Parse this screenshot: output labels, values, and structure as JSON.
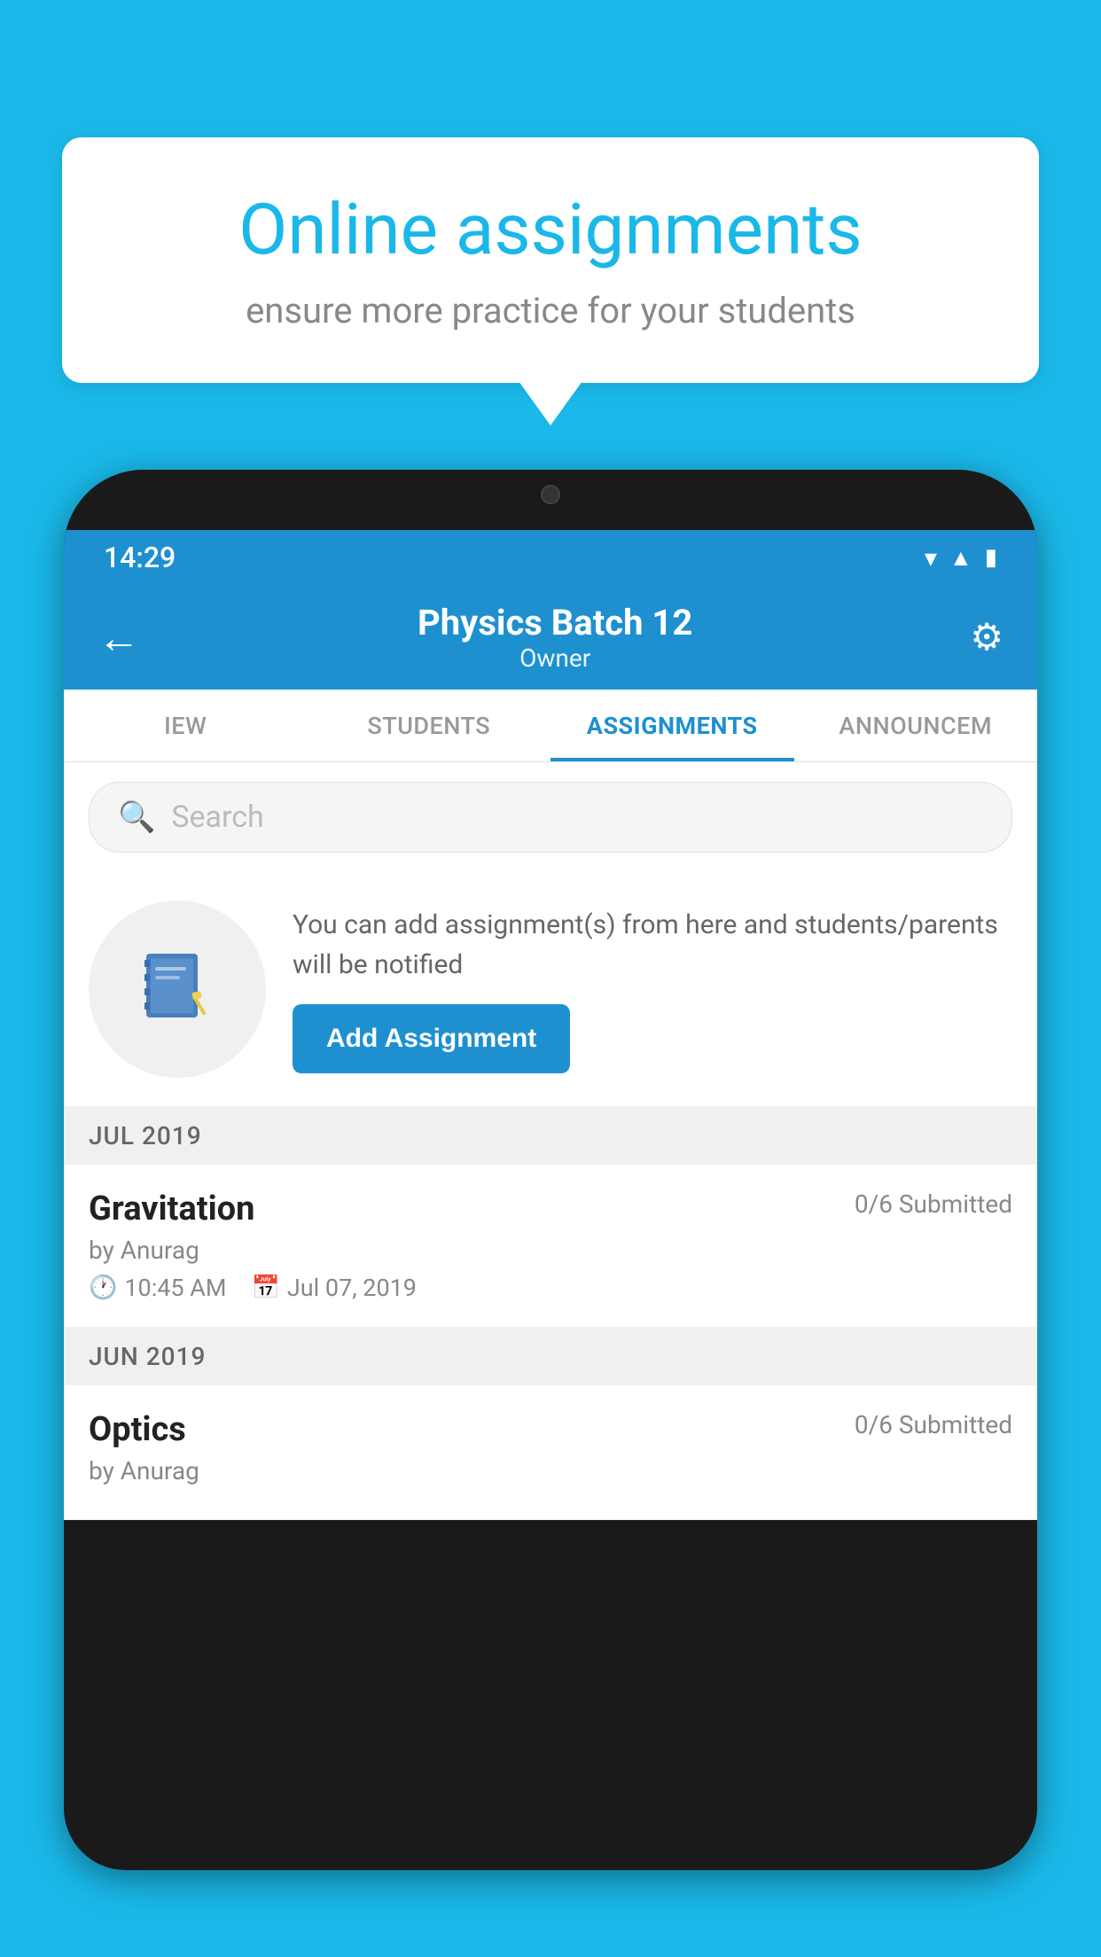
{
  "background_color": "#1ab8e8",
  "bubble": {
    "title": "Online assignments",
    "subtitle": "ensure more practice for your students"
  },
  "phone": {
    "status_bar": {
      "time": "14:29",
      "wifi_icon": "wifi",
      "signal_icon": "signal",
      "battery_icon": "battery"
    },
    "header": {
      "title": "Physics Batch 12",
      "subtitle": "Owner",
      "back_label": "←",
      "settings_label": "⚙"
    },
    "tabs": [
      {
        "label": "IEW",
        "active": false
      },
      {
        "label": "STUDENTS",
        "active": false
      },
      {
        "label": "ASSIGNMENTS",
        "active": true
      },
      {
        "label": "ANNOUNCEM",
        "active": false
      }
    ],
    "search": {
      "placeholder": "Search"
    },
    "promo": {
      "description": "You can add assignment(s) from here and students/parents will be notified",
      "button_label": "Add Assignment"
    },
    "sections": [
      {
        "label": "JUL 2019",
        "assignments": [
          {
            "name": "Gravitation",
            "status": "0/6 Submitted",
            "by": "by Anurag",
            "time": "10:45 AM",
            "date": "Jul 07, 2019"
          }
        ]
      },
      {
        "label": "JUN 2019",
        "assignments": [
          {
            "name": "Optics",
            "status": "0/6 Submitted",
            "by": "by Anurag",
            "time": "",
            "date": ""
          }
        ]
      }
    ]
  }
}
